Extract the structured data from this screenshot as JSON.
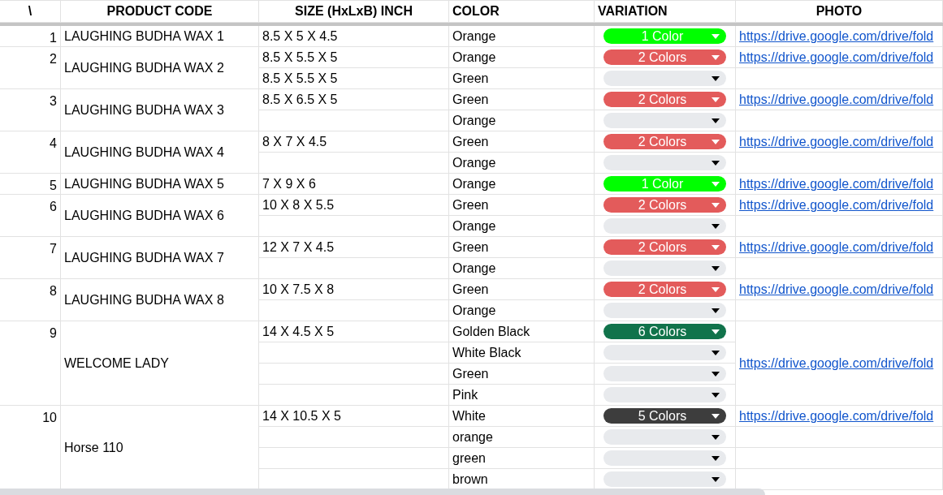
{
  "header": [
    "\\",
    "PRODUCT CODE",
    "SIZE (HxLxB) INCH",
    "COLOR",
    "VARIATION",
    "PHOTO"
  ],
  "products": [
    {
      "number": "1",
      "code": "LAUGHING BUDHA WAX 1",
      "link": "https://drive.google.com/drive/fold",
      "variants": [
        {
          "size": "8.5 X 5 X 4.5",
          "color_name": "Orange",
          "chip": {
            "label": "1 Color",
            "color": "#00ff00"
          }
        }
      ]
    },
    {
      "number": "2",
      "code": "LAUGHING BUDHA WAX 2",
      "link": "https://drive.google.com/drive/fold",
      "photo_merged": false,
      "variants": [
        {
          "size": "8.5 X 5.5 X 5",
          "color_name": "Orange",
          "chip": {
            "label": "2 Colors",
            "color": "#e35b5b"
          }
        },
        {
          "size": "8.5 X 5.5 X 5",
          "color_name": "Green",
          "chip": {
            "color": "#e8eaed"
          }
        }
      ]
    },
    {
      "number": "3",
      "code": "LAUGHING BUDHA WAX 3",
      "link": "https://drive.google.com/drive/fold",
      "photo_merged": false,
      "variants": [
        {
          "size": "8.5 X 6.5 X 5",
          "color_name": "Green",
          "chip": {
            "label": "2 Colors",
            "color": "#e35b5b"
          }
        },
        {
          "color_name": "Orange",
          "chip": {
            "color": "#e8eaed"
          }
        }
      ]
    },
    {
      "number": "4",
      "code": "LAUGHING BUDHA WAX 4",
      "link": "https://drive.google.com/drive/fold",
      "photo_merged": false,
      "variants": [
        {
          "size": "8 X 7 X 4.5",
          "color_name": "Green",
          "chip": {
            "label": "2 Colors",
            "color": "#e35b5b"
          }
        },
        {
          "color_name": "Orange",
          "chip": {
            "color": "#e8eaed"
          }
        }
      ]
    },
    {
      "number": "5",
      "code": "LAUGHING BUDHA WAX 5",
      "link": "https://drive.google.com/drive/fold",
      "variants": [
        {
          "size": "7 X 9 X 6",
          "color_name": "Orange",
          "chip": {
            "label": "1 Color",
            "color": "#00ff00"
          }
        }
      ]
    },
    {
      "number": "6",
      "code": "LAUGHING BUDHA WAX 6",
      "link": "https://drive.google.com/drive/fold",
      "photo_merged": false,
      "variants": [
        {
          "size": "10 X 8 X 5.5",
          "color_name": "Green",
          "chip": {
            "label": "2 Colors",
            "color": "#e35b5b"
          }
        },
        {
          "color_name": "Orange",
          "chip": {
            "color": "#e8eaed"
          }
        }
      ]
    },
    {
      "number": "7",
      "code": "LAUGHING BUDHA WAX 7",
      "link": "https://drive.google.com/drive/fold",
      "photo_merged": false,
      "variants": [
        {
          "size": "12 X 7 X 4.5",
          "color_name": "Green",
          "chip": {
            "label": "2 Colors",
            "color": "#e35b5b"
          }
        },
        {
          "color_name": "Orange",
          "chip": {
            "color": "#e8eaed"
          }
        }
      ]
    },
    {
      "number": "8",
      "code": "LAUGHING BUDHA WAX 8",
      "link": "https://drive.google.com/drive/fold",
      "photo_merged": false,
      "variants": [
        {
          "size": "10 X 7.5 X 8",
          "color_name": "Green",
          "chip": {
            "label": "2 Colors",
            "color": "#e35b5b"
          }
        },
        {
          "color_name": "Orange",
          "chip": {
            "color": "#e8eaed"
          }
        }
      ]
    },
    {
      "number": "9",
      "code": "WELCOME LADY",
      "link": "https://drive.google.com/drive/fold",
      "photo_merged": true,
      "variants": [
        {
          "size": "14 X 4.5 X 5",
          "color_name": "Golden Black",
          "chip": {
            "label": "6 Colors",
            "color": "#11734b"
          }
        },
        {
          "color_name": "White Black",
          "chip": {
            "color": "#e8eaed"
          }
        },
        {
          "color_name": "Green",
          "chip": {
            "color": "#e8eaed"
          }
        },
        {
          "color_name": "Pink",
          "chip": {
            "color": "#e8eaed"
          }
        }
      ]
    },
    {
      "number": "10",
      "code": "Horse 110",
      "link": "https://drive.google.com/drive/fold",
      "photo_merged": false,
      "variants": [
        {
          "size": "14 X 10.5 X 5",
          "color_name": "White",
          "chip": {
            "label": "5 Colors",
            "color": "#3d3d3d"
          }
        },
        {
          "color_name": "orange",
          "chip": {
            "color": "#e8eaed"
          }
        },
        {
          "color_name": "green",
          "chip": {
            "color": "#e8eaed"
          }
        },
        {
          "color_name": "brown",
          "chip": {
            "color": "#e8eaed"
          }
        }
      ]
    }
  ]
}
